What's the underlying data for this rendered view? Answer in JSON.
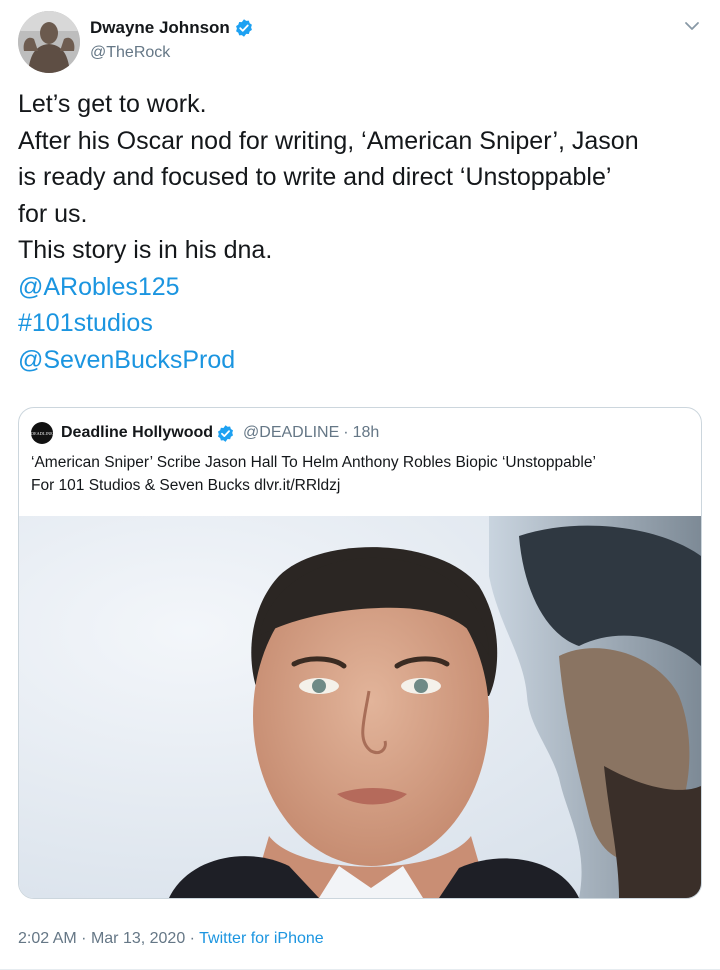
{
  "author": {
    "display_name": "Dwayne Johnson",
    "handle": "@TheRock",
    "verified": true
  },
  "tweet": {
    "lines": [
      {
        "text": "Let’s get to work.",
        "link": false
      },
      {
        "text": "After his Oscar nod for writing, ‘American Sniper’, Jason",
        "link": false
      },
      {
        "text": "is ready and focused to write and direct ‘Unstoppable’",
        "link": false
      },
      {
        "text": "for us.",
        "link": false
      },
      {
        "text": "This story is in his dna.",
        "link": false
      },
      {
        "text": "@ARobles125",
        "link": true
      },
      {
        "text": "#101studios",
        "link": true
      },
      {
        "text": "@SevenBucksProd",
        "link": true
      }
    ]
  },
  "quoted_tweet": {
    "avatar_text": "DEADLINE",
    "display_name": "Deadline Hollywood",
    "handle": "@DEADLINE",
    "separator": "·",
    "time": "18h",
    "text_lines": [
      "‘American Sniper’ Scribe Jason Hall To Helm Anthony Robles Biopic ‘Unstoppable’",
      "For 101 Studios & Seven Bucks dlvr.it/RRldzj"
    ]
  },
  "footer": {
    "time": "2:02 AM",
    "sep1": "·",
    "date": "Mar 13, 2020",
    "sep2": "·",
    "source": "Twitter for iPhone"
  },
  "colors": {
    "link": "#1b95e0",
    "verified": "#1da1f2",
    "secondary_text": "#657786",
    "border": "#ccd6dd"
  },
  "icons": {
    "verified": "verified-badge-icon",
    "menu": "chevron-down-icon"
  }
}
